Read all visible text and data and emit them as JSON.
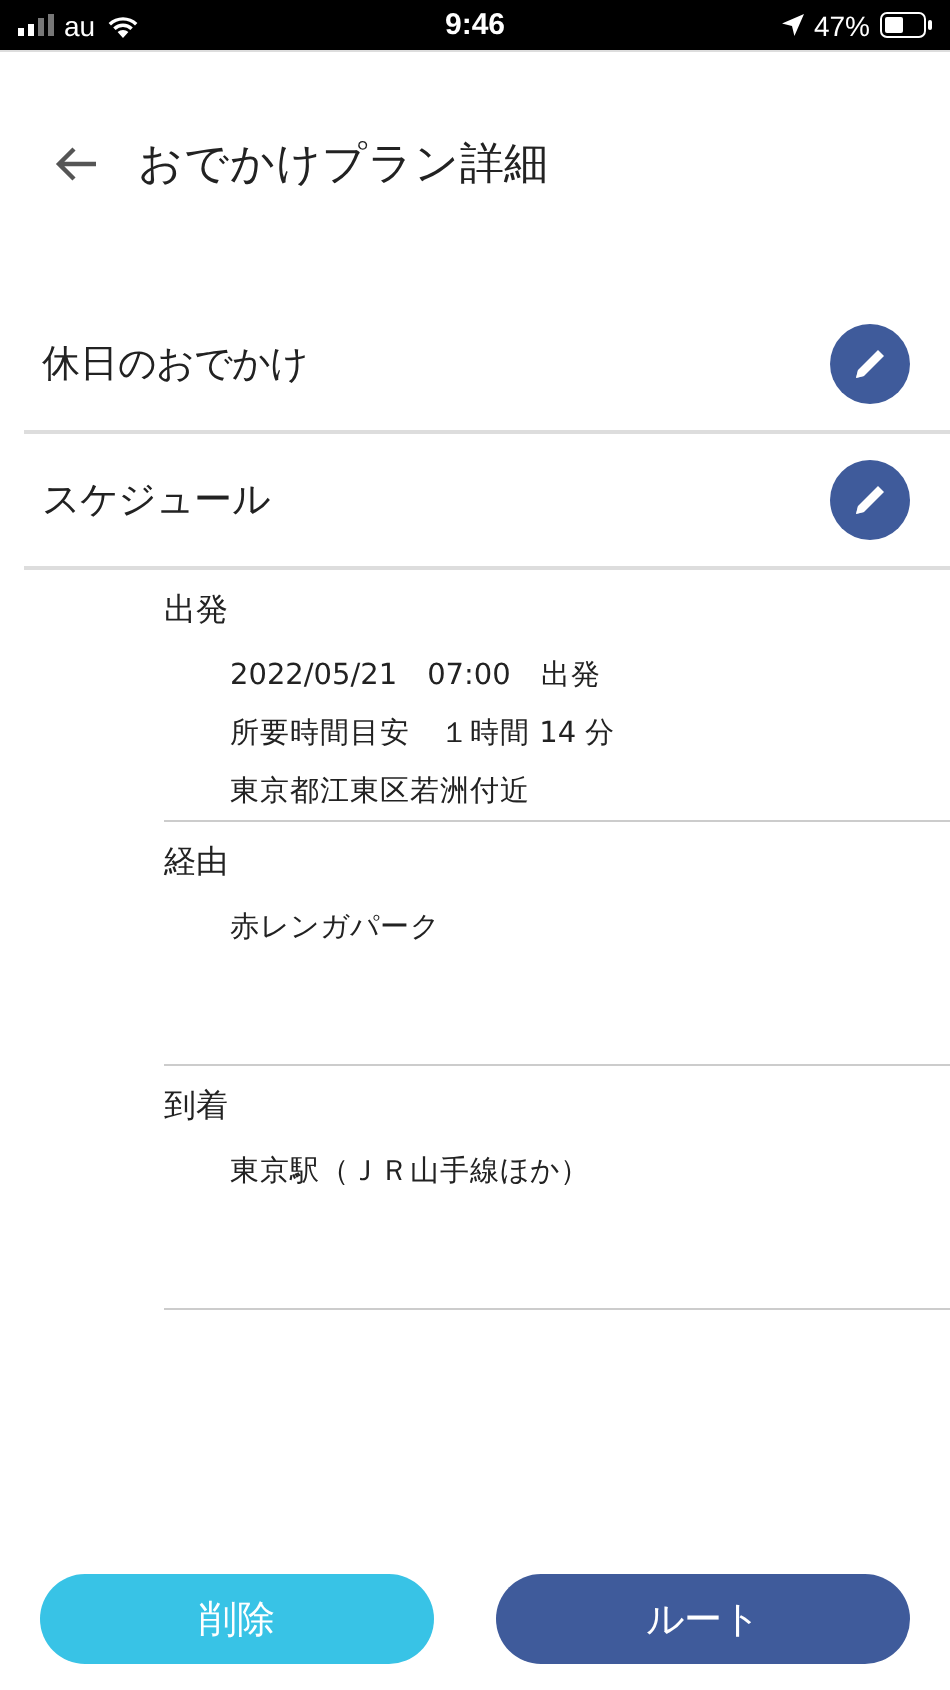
{
  "status_bar": {
    "carrier": "au",
    "time": "9:46",
    "battery": "47%"
  },
  "header": {
    "title": "おでかけプラン詳細"
  },
  "rows": [
    {
      "label": "休日のおでかけ"
    },
    {
      "label": "スケジュール"
    }
  ],
  "sections": [
    {
      "heading": "出発",
      "lines": [
        "2022/05/21　07:00　出発",
        "所要時間目安　１時間 14 分",
        "東京都江東区若洲付近"
      ]
    },
    {
      "heading": "経由",
      "lines": [
        "赤レンガパーク"
      ]
    },
    {
      "heading": "到着",
      "lines": [
        "東京駅（ＪＲ山手線ほか）"
      ]
    }
  ],
  "buttons": [
    {
      "label": "削除",
      "kind": "secondary"
    },
    {
      "label": "ルート",
      "kind": "primary"
    }
  ]
}
